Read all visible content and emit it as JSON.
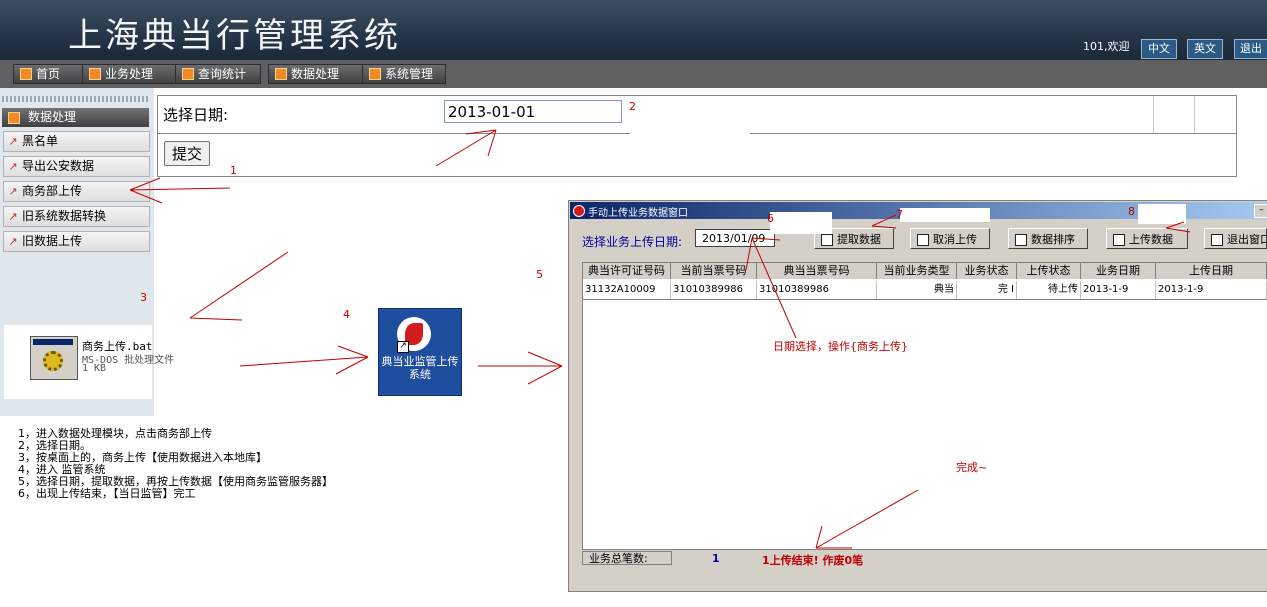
{
  "header": {
    "title": "上海典当行管理系统",
    "welcome": "101,欢迎",
    "lang_cn": "中文",
    "lang_en": "英文",
    "logout": "退出"
  },
  "menu": [
    {
      "label": "首页"
    },
    {
      "label": "业务处理"
    },
    {
      "label": "查询统计"
    },
    {
      "label": "数据处理"
    },
    {
      "label": "系统管理"
    }
  ],
  "sidebar": {
    "header": "数据处理",
    "items": [
      {
        "label": "黑名单"
      },
      {
        "label": "导出公安数据"
      },
      {
        "label": "商务部上传"
      },
      {
        "label": "旧系统数据转换"
      },
      {
        "label": "旧数据上传"
      }
    ]
  },
  "form": {
    "date_label": "选择日期:",
    "date_value": "2013-01-01",
    "submit_label": "提交"
  },
  "desktop": {
    "bat_name": "商务上传.bat",
    "bat_type": "MS-DOS 批处理文件",
    "bat_size": "1 KB",
    "shortcut_label": "典当业监管上传系统"
  },
  "steps": [
    "1，进入数据处理模块，点击商务部上传",
    "2，选择日期。",
    "3，按桌面上的，商务上传【使用数据进入本地库】",
    "4，进入 监管系统",
    "5，选择日期，提取数据，再按上传数据【使用商务监管服务器】",
    "6，出现上传结束，【当日监管】完工"
  ],
  "upload_window": {
    "title": "手动上传业务数据窗口",
    "date_label": "选择业务上传日期:",
    "date_value": "2013/01/09",
    "buttons": {
      "fetch": "提取数据",
      "cancel": "取消上传",
      "sort": "数据排序",
      "upload": "上传数据",
      "exit": "退出窗口"
    },
    "columns": [
      "典当许可证号码",
      "当前当票号码",
      "典当当票号码",
      "当前业务类型",
      "业务状态",
      "上传状态",
      "业务日期",
      "上传日期"
    ],
    "rows": [
      [
        "31132A10009",
        "31010389986",
        "31010389986",
        "典当",
        "完 I",
        "待上传",
        "2013-1-9",
        "2013-1-9"
      ]
    ],
    "total_label": "业务总笔数:",
    "total_value": "1",
    "result_message": "1上传结束! 作废0笔"
  },
  "annotations": {
    "n1": "1",
    "n2": "2",
    "n3": "3",
    "n4": "4",
    "n5": "5",
    "n6": "6",
    "n7": "7",
    "n8": "8",
    "note_date": "日期选择，操作{商务上传}",
    "note_done": "完成~"
  },
  "colors": {
    "header_bg": "#223244",
    "annotation_red": "#c00000",
    "menu_icon_orange": "#f08a24",
    "window_titlebar": "#0a246a"
  }
}
